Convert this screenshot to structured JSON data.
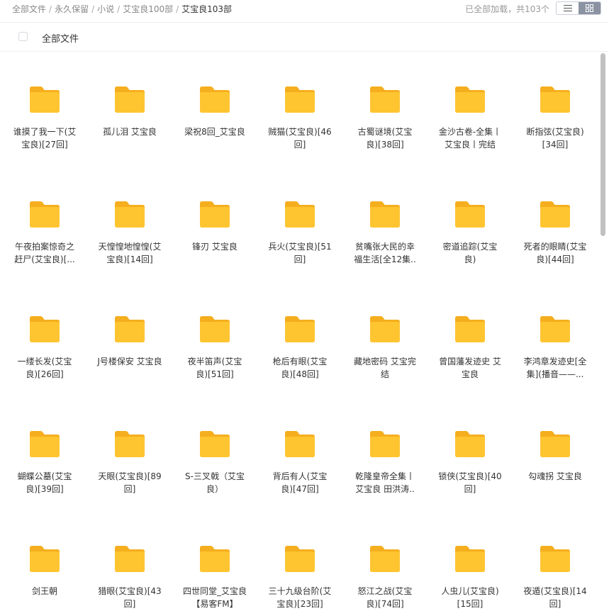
{
  "breadcrumb": {
    "items": [
      "全部文件",
      "永久保留",
      "小说",
      "艾宝良100部"
    ],
    "current": "艾宝良103部",
    "separator": "/"
  },
  "status_text": "已全部加载，共103个",
  "view_toggle": {
    "list_icon": "list-view-icon",
    "grid_icon": "grid-view-icon",
    "active": "grid"
  },
  "list_header": {
    "label": "全部文件"
  },
  "colors": {
    "folder": "#FFC531",
    "folder_back": "#F5AE1E",
    "active_toggle": "#8B93A3"
  },
  "folders": [
    "谁摸了我一下(艾宝良)[27回]",
    "孤儿泪 艾宝良",
    "梁祝8回_艾宝良",
    "贼猫(艾宝良)[46回]",
    "古蜀谜境(艾宝良)[38回]",
    "金沙古卷-全集丨艾宝良丨完结",
    "断指弦(艾宝良)[34回]",
    "午夜拍案惊奇之赶尸(艾宝良)[...",
    "天惶惶地惶惶(艾宝良)[14回]",
    "锋刃 艾宝良",
    "兵火(艾宝良)[51回]",
    "贫嘴张大民的幸福生活[全12集..",
    "密道追踪(艾宝良)",
    "死者的眼睛(艾宝良)[44回]",
    "一缕长发(艾宝良)[26回]",
    "J号楼保安 艾宝良",
    "夜半笛声(艾宝良)[51回]",
    "枪后有眼(艾宝良)[48回]",
    "藏地密码 艾宝完结",
    "曾国藩发迹史 艾宝良",
    "李鸿章发迹史[全集](播音——...",
    "蝴蝶公墓(艾宝良)[39回]",
    "天眼(艾宝良)[89回]",
    "S-三叉戟（艾宝良）",
    "背后有人(艾宝良)[47回]",
    "乾隆皇帝全集丨艾宝良 田洪涛..",
    "锁侠(艾宝良)[40回]",
    "勾魂拐 艾宝良",
    "剑王朝",
    "猎眼(艾宝良)[43回]",
    "四世同堂_艾宝良【易客FM】",
    "三十九级台阶(艾宝良)[23回]",
    "怒江之战(艾宝良)[74回]",
    "人虫儿(艾宝良)[15回]",
    "夜遁(艾宝良)[14回]"
  ]
}
